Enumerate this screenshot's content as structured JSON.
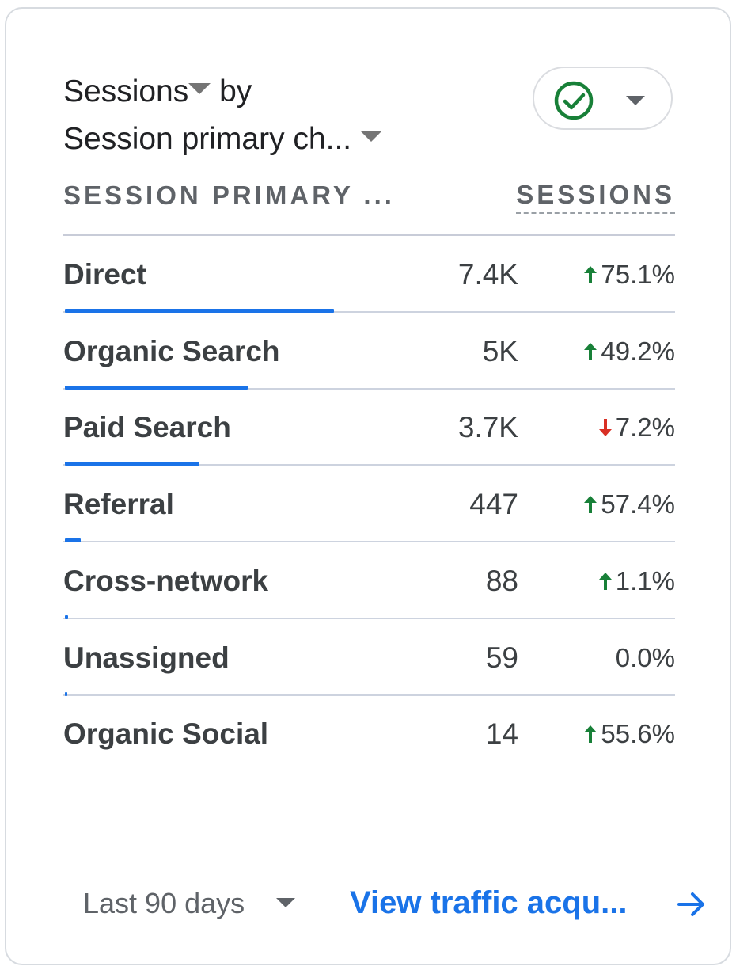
{
  "card": {
    "title_metric": "Sessions",
    "title_by": "by",
    "title_dimension": "Session primary ch...",
    "compare_chip_icon": "check-circle-icon",
    "column_dimension": "SESSION PRIMARY ...",
    "column_metric": "SESSIONS"
  },
  "rows": [
    {
      "label": "Direct",
      "value": "7.4K",
      "change": "75.1%",
      "direction": "up",
      "share": 1.0
    },
    {
      "label": "Organic Search",
      "value": "5K",
      "change": "49.2%",
      "direction": "up",
      "share": 0.68
    },
    {
      "label": "Paid Search",
      "value": "3.7K",
      "change": "7.2%",
      "direction": "down",
      "share": 0.5
    },
    {
      "label": "Referral",
      "value": "447",
      "change": "57.4%",
      "direction": "up",
      "share": 0.06
    },
    {
      "label": "Cross-network",
      "value": "88",
      "change": "1.1%",
      "direction": "up",
      "share": 0.012
    },
    {
      "label": "Unassigned",
      "value": "59",
      "change": "0.0%",
      "direction": "none",
      "share": 0.008
    },
    {
      "label": "Organic Social",
      "value": "14",
      "change": "55.6%",
      "direction": "up",
      "share": 0.0
    }
  ],
  "footer": {
    "date_range": "Last 90 days",
    "link_label": "View traffic acqu...",
    "link_icon": "arrow-right-icon"
  },
  "colors": {
    "accent": "#1a73e8",
    "up": "#188038",
    "down": "#d93025"
  }
}
